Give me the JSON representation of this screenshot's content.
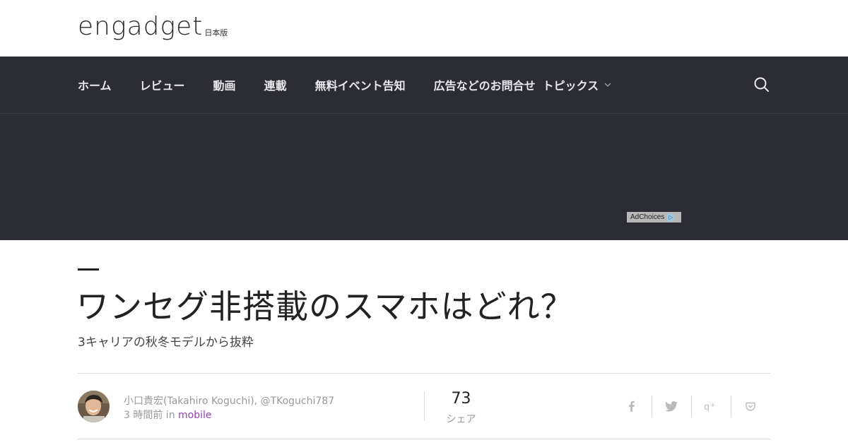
{
  "header": {
    "logo_text": "engadget",
    "logo_sub": "日本版"
  },
  "nav": {
    "items": [
      {
        "label": "ホーム"
      },
      {
        "label": "レビュー"
      },
      {
        "label": "動画"
      },
      {
        "label": "連載"
      },
      {
        "label": "無料イベント告知"
      },
      {
        "label": "広告などのお問合せ"
      },
      {
        "label": "トピックス"
      }
    ],
    "search_icon": "search-icon"
  },
  "ad": {
    "adchoices_label": "AdChoices"
  },
  "article": {
    "title": "ワンセグ非搭載のスマホはどれ？",
    "subtitle": "3キャリアの秋冬モデルから抜粋",
    "author": "小口貴宏(Takahiro Koguchi), @TKoguchi787",
    "time_prefix": "3 時間前 in ",
    "category": "mobile",
    "share_count": "73",
    "share_label": "シェア"
  },
  "social": [
    "facebook-icon",
    "twitter-icon",
    "google-plus-icon",
    "pocket-icon"
  ],
  "colors": {
    "nav_bg": "#2c2c34",
    "category_link": "#8e44ad"
  }
}
